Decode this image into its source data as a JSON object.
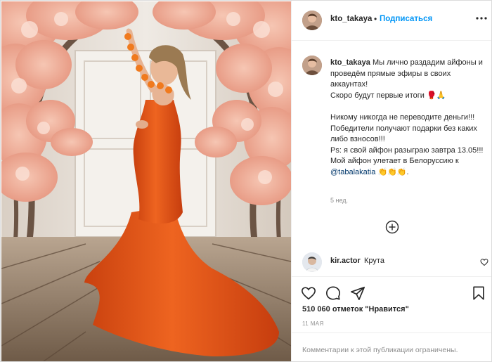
{
  "header": {
    "username": "kto_takaya",
    "separator": "•",
    "follow_label": "Подписаться"
  },
  "caption": {
    "username": "kto_takaya",
    "line1": "Мы лично раздадим айфоны и проведём прямые эфиры в своих аккаунтах!",
    "line2": "Скоро будут первые итоги 🥊🙏",
    "line3": "Никому никогда не переводите деньги!!! Победители получают подарки без каких либо взносов!!!",
    "line4": "Ps: я свой айфон разыграю завтра 13.05!!!",
    "line5_prefix": "Мой айфон улетает в Белоруссию к",
    "mention": "@tabalakatia",
    "line5_suffix": "👏👏👏.",
    "time_ago": "5 нед."
  },
  "comment": {
    "username": "kir.actor",
    "text": "Крута"
  },
  "likes": {
    "text": "510 060 отметок \"Нравится\""
  },
  "post_date": "11 МАЯ",
  "comments_limited": "Комментарии к этой публикации ограничены.",
  "icons": {
    "more": "more-options-icon",
    "load_more": "plus-circle-icon",
    "comment_like": "heart-outline-icon",
    "like": "heart-outline-icon",
    "comment": "comment-bubble-icon",
    "share": "paper-plane-icon",
    "save": "bookmark-icon"
  },
  "colors": {
    "accent": "#0095f6",
    "mention": "#00376b",
    "text": "#262626",
    "muted": "#8e8e8e",
    "divider": "#efefef",
    "dress": "#e8581a"
  }
}
